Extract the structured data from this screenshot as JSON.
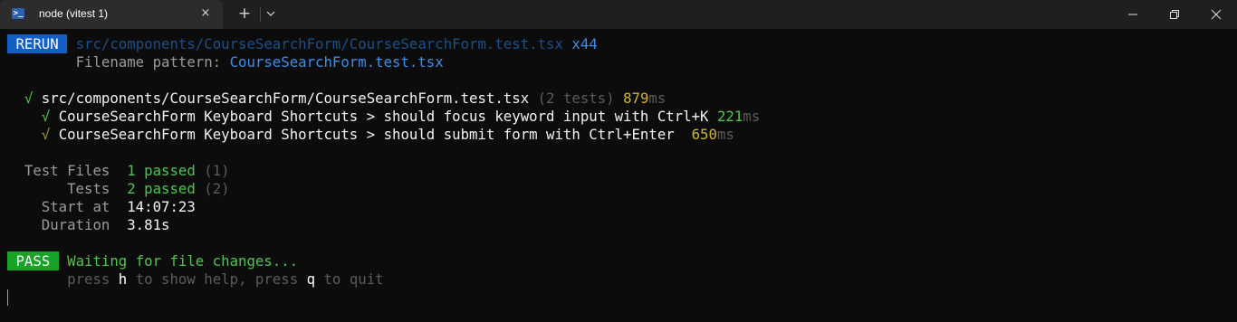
{
  "titlebar": {
    "tab_title": "node (vitest 1)",
    "tab_icon": "powershell-icon",
    "close_tab": "×",
    "new_tab": "+",
    "dropdown_icon": "chevron-down-icon",
    "window_controls": [
      "minimize-icon",
      "restore-icon",
      "close-icon"
    ]
  },
  "terminal": {
    "rerun": {
      "badge": " RERUN ",
      "path": "src/components/CourseSearchForm/CourseSearchForm.test.tsx",
      "count": "x44",
      "pattern_label": "Filename pattern: ",
      "pattern_value": "CourseSearchForm.test.tsx"
    },
    "file_result": {
      "check": "√",
      "path": "src/components/CourseSearchForm/CourseSearchForm.test.tsx",
      "count": "(2 tests)",
      "time_value": "879",
      "time_unit": "ms"
    },
    "tests": [
      {
        "check": "√",
        "name": "CourseSearchForm Keyboard Shortcuts > should focus keyword input with Ctrl+K",
        "time_value": "221",
        "time_unit": "ms"
      },
      {
        "check": "√",
        "name": "CourseSearchForm Keyboard Shortcuts > should submit form with Ctrl+Enter ",
        "time_value": "650",
        "time_unit": "ms"
      }
    ],
    "summary": {
      "test_files_label": "Test Files  ",
      "test_files_passed": "1 passed",
      "test_files_total": " (1)",
      "tests_label": "     Tests  ",
      "tests_passed": "2 passed",
      "tests_total": " (2)",
      "start_label": "  Start at  ",
      "start_value": "14:07:23",
      "duration_label": "  Duration  ",
      "duration_value": "3.81s"
    },
    "pass": {
      "badge": " PASS ",
      "waiting": "Waiting for file changes...",
      "help_prefix": "press ",
      "help_key_h": "h",
      "help_mid": " to show help, press ",
      "help_key_q": "q",
      "help_suffix": " to quit"
    },
    "colors": {
      "background": "#0c0c0c",
      "rerun_badge": "#0f5fc4",
      "pass_badge": "#16a326",
      "green": "#4ec44e",
      "yellow": "#cfb438",
      "blue": "#3b8eea"
    }
  }
}
